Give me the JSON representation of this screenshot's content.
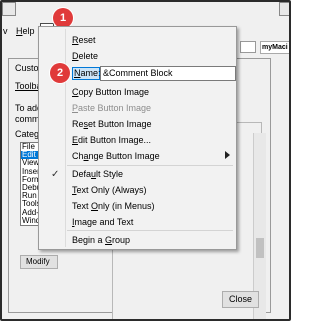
{
  "markers": [
    "1",
    "2"
  ],
  "menubar": {
    "view_partial": "v",
    "help": "Help",
    "macro_box": "myMaci"
  },
  "dialog": {
    "title_partial": "Customi",
    "tab_partial": "Toolbars",
    "text_line1": "To add a",
    "text_line2": "comman",
    "categories_label": "Categori",
    "categories": [
      "File",
      "Edit",
      "View",
      "Insert",
      "Format",
      "Debug",
      "Run",
      "Tools",
      "Add-Ins",
      "Window"
    ],
    "selected_category": "Edit",
    "modify_label": "Modify",
    "close_label": "Close"
  },
  "menu": {
    "reset": "Reset",
    "delete": "Delete",
    "name_label": "Name:",
    "name_value": "&Comment Block",
    "copy_button_image": "Copy Button Image",
    "paste_button_image": "Paste Button Image",
    "reset_button_image": "Reset Button Image",
    "edit_button_image": "Edit Button Image...",
    "change_button_image": "Change Button Image",
    "default_style": "Default Style",
    "text_only_always": "Text Only (Always)",
    "text_only_menus": "Text Only (in Menus)",
    "image_and_text": "Image and Text",
    "begin_group": "Begin a Group"
  },
  "colors": {
    "marker": "#e03a3a",
    "selection": "#0078d7"
  }
}
